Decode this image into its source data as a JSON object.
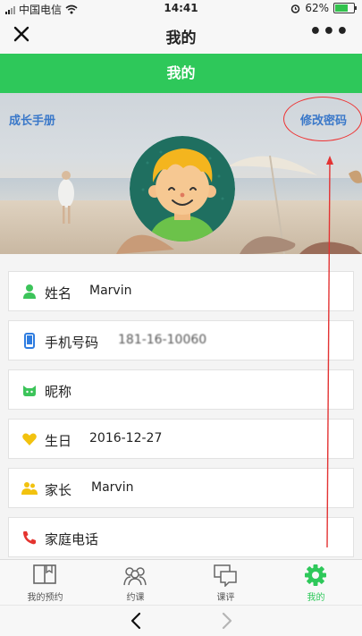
{
  "status_bar": {
    "carrier": "中国电信",
    "time": "14:41",
    "battery": "62%"
  },
  "navbar": {
    "title": "我的"
  },
  "header_bar": {
    "title": "我的"
  },
  "banner": {
    "left_link": "成长手册",
    "right_link": "修改密码"
  },
  "fields": [
    {
      "label": "姓名",
      "value": "Marvin",
      "icon": "person-icon",
      "color": "#3cc45a"
    },
    {
      "label": "手机号码",
      "value": "181-16-10060",
      "icon": "phone-icon",
      "color": "#2f7de0"
    },
    {
      "label": "昵称",
      "value": "",
      "icon": "nickname-icon",
      "color": "#3cc45a"
    },
    {
      "label": "生日",
      "value": "2016-12-27",
      "icon": "heart-icon",
      "color": "#f2c20f"
    },
    {
      "label": "家长",
      "value": "Marvin",
      "icon": "parents-icon",
      "color": "#f2c20f"
    },
    {
      "label": "家庭电话",
      "value": "",
      "icon": "telephone-icon",
      "color": "#e4342f"
    }
  ],
  "tabs": [
    {
      "label": "我的预约",
      "icon": "book-icon"
    },
    {
      "label": "约课",
      "icon": "group-icon"
    },
    {
      "label": "课评",
      "icon": "chat-icon"
    },
    {
      "label": "我的",
      "icon": "gear-icon",
      "active": true
    }
  ],
  "colors": {
    "accent": "#2ec85a",
    "link": "#3a78c9",
    "annotation": "#e33333"
  }
}
